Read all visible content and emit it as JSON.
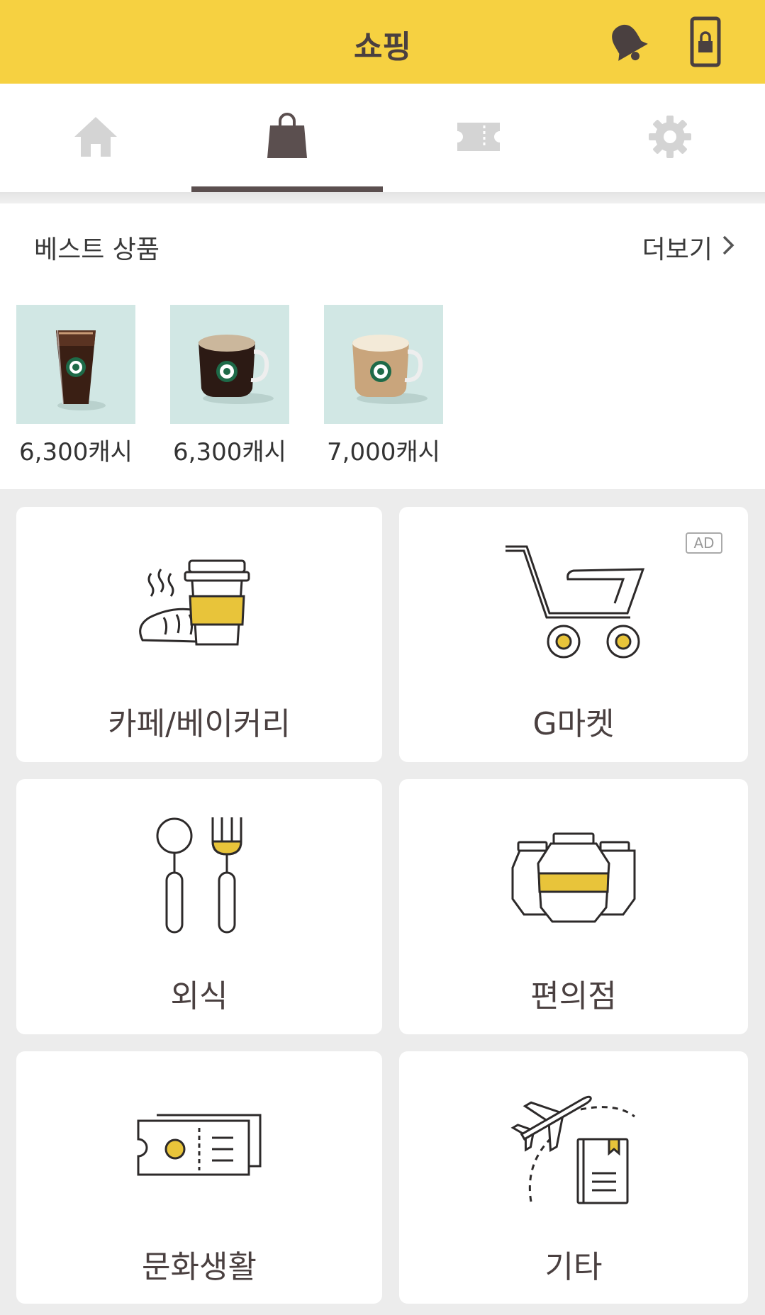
{
  "header": {
    "title": "쇼핑",
    "bell_icon": "bell-icon",
    "lock_icon": "phone-lock-icon",
    "background": "#f6d141"
  },
  "tabs": [
    {
      "name": "home",
      "icon": "home-icon",
      "active": false
    },
    {
      "name": "shopping",
      "icon": "shopping-bag-icon",
      "active": true
    },
    {
      "name": "coupon",
      "icon": "ticket-icon",
      "active": false
    },
    {
      "name": "settings",
      "icon": "gear-icon",
      "active": false
    }
  ],
  "best": {
    "title": "베스트 상품",
    "more_label": "더보기",
    "products": [
      {
        "price": "6,300캐시"
      },
      {
        "price": "6,300캐시"
      },
      {
        "price": "7,000캐시"
      }
    ]
  },
  "categories": [
    {
      "label": "카페/베이커리",
      "icon": "cafe-bakery-icon"
    },
    {
      "label": "G마켓",
      "icon": "shopping-cart-icon",
      "badge": "AD"
    },
    {
      "label": "외식",
      "icon": "spoon-fork-icon"
    },
    {
      "label": "편의점",
      "icon": "convenience-jars-icon"
    },
    {
      "label": "문화생활",
      "icon": "ticket-culture-icon"
    },
    {
      "label": "기타",
      "icon": "airplane-book-icon"
    }
  ],
  "colors": {
    "accent": "#f6d141",
    "icon_dark": "#5b4f4f",
    "icon_light": "#d4d4d4",
    "icon_fill_yellow": "#e8c43a"
  }
}
